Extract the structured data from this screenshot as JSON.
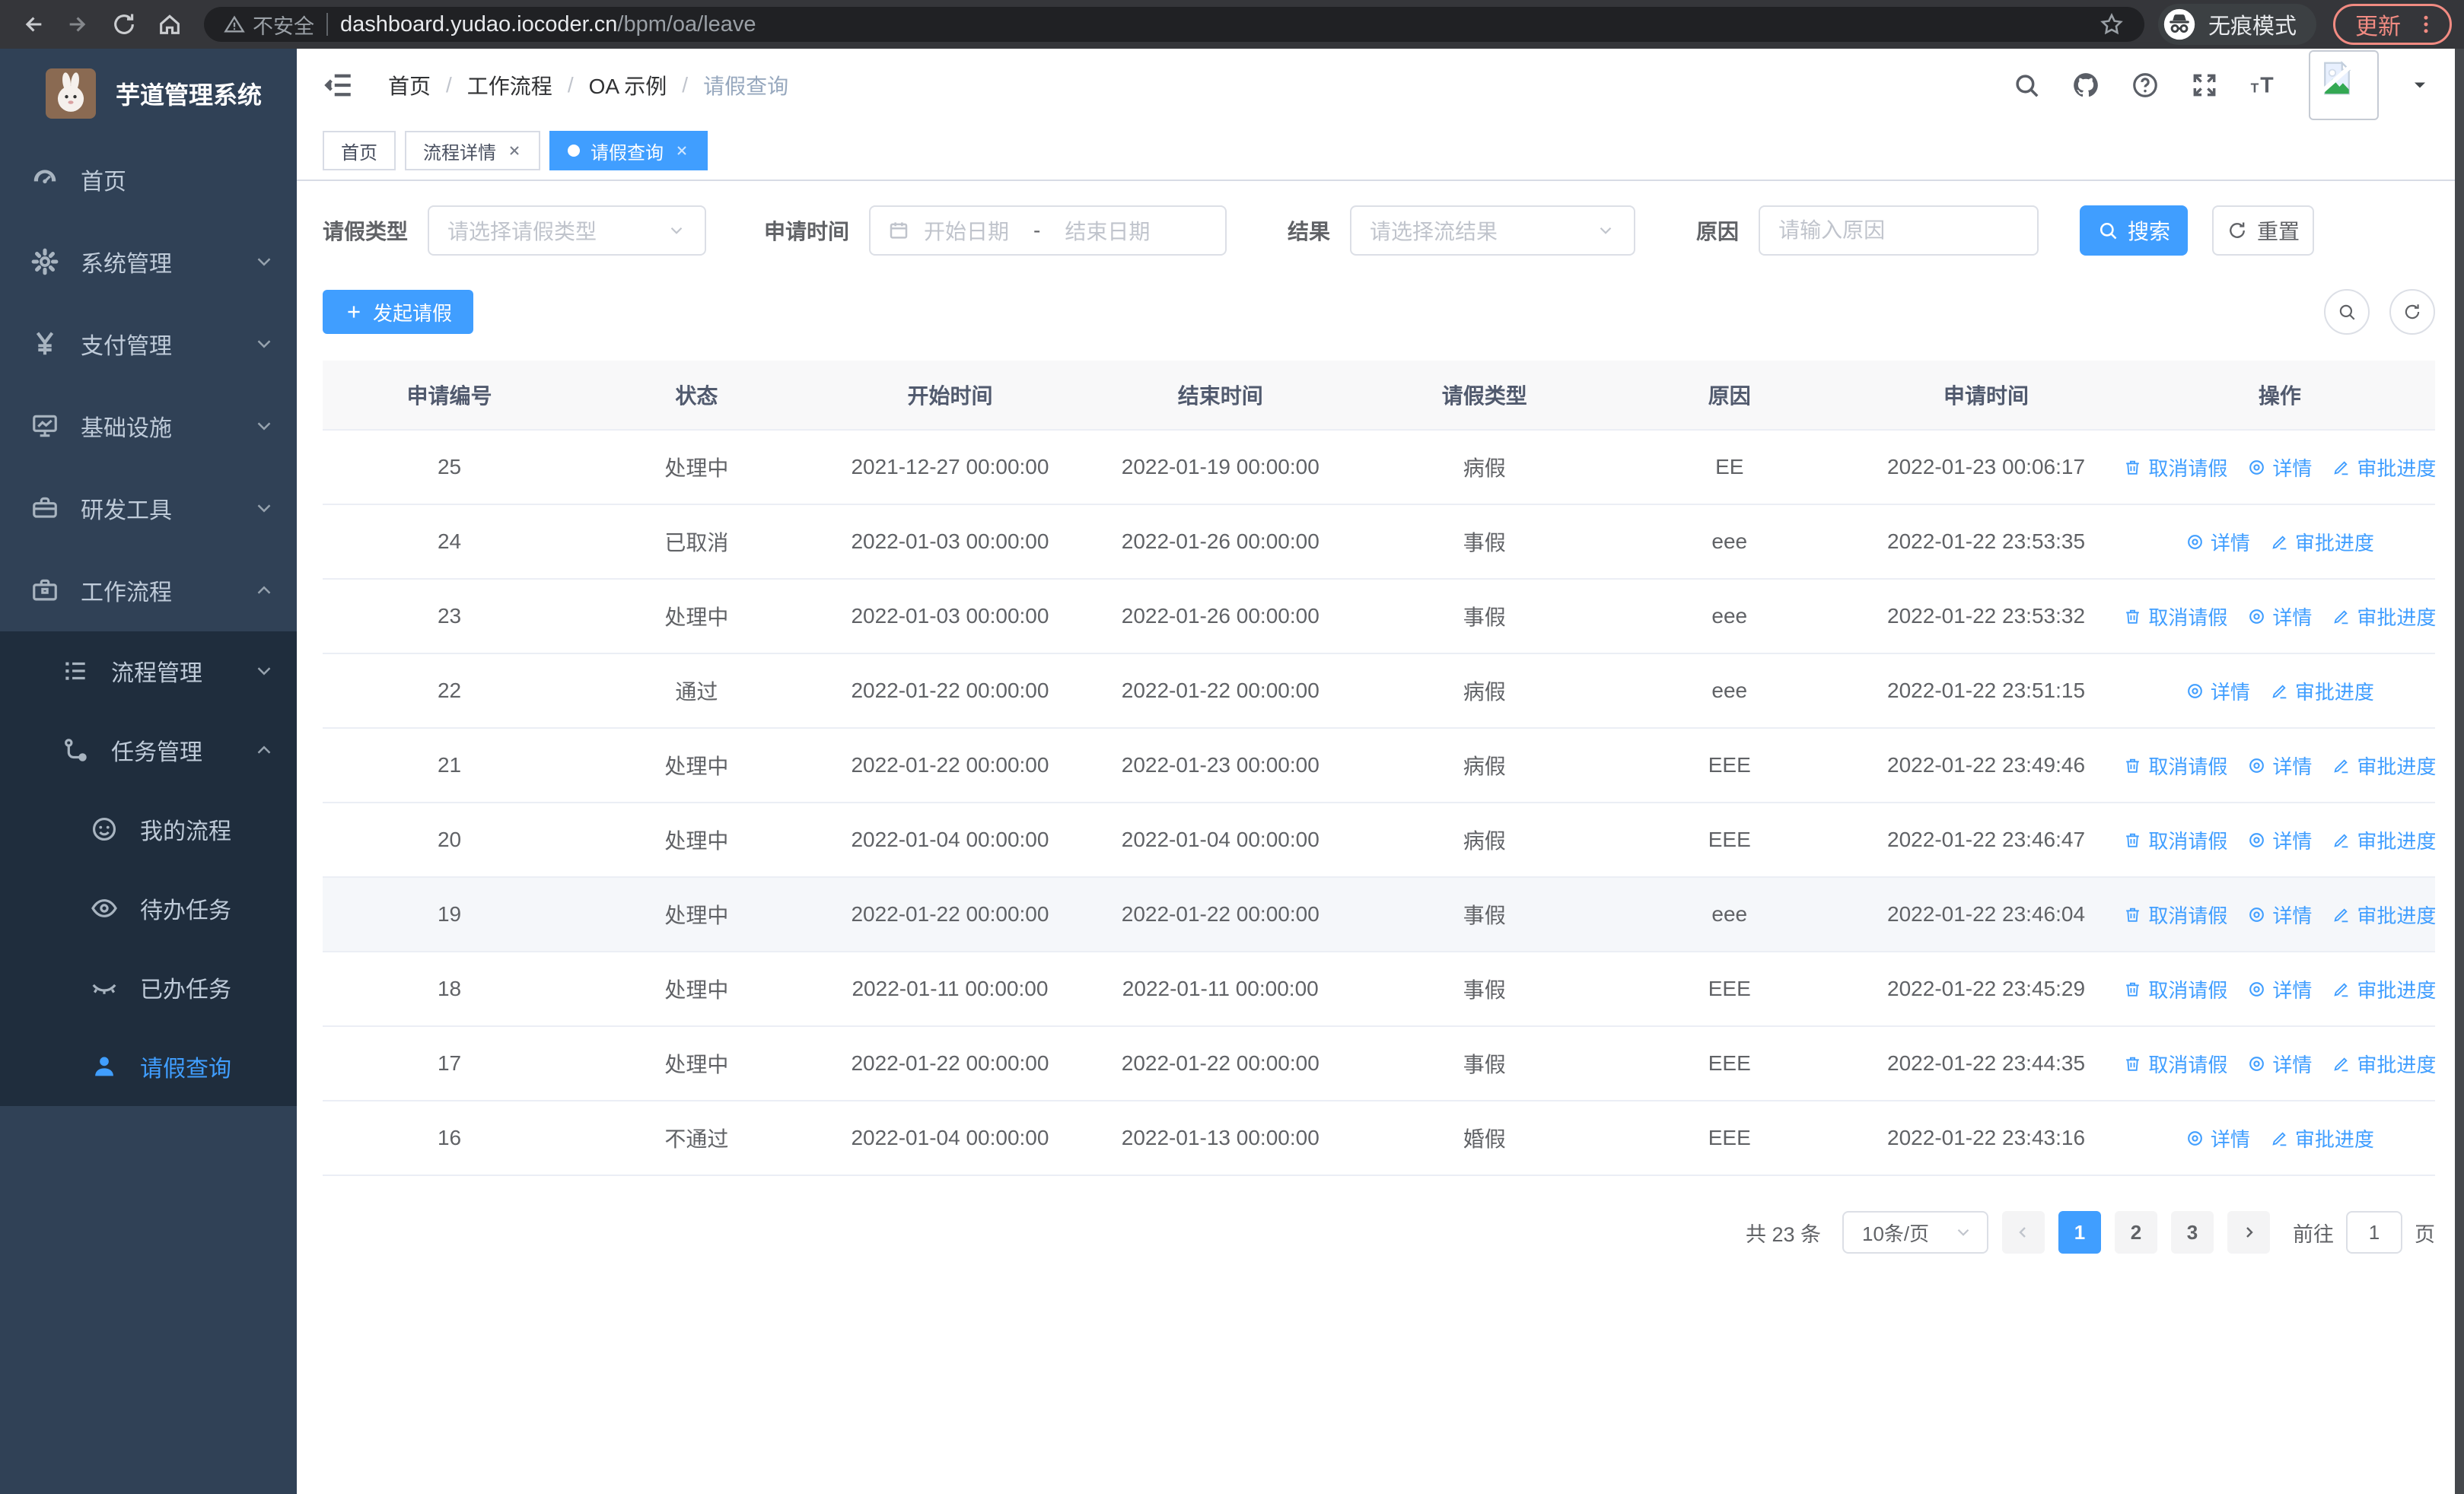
{
  "browser": {
    "security_warning": "不安全",
    "url_host": "dashboard.yudao.iocoder.cn",
    "url_path": "/bpm/oa/leave",
    "incognito_label": "无痕模式",
    "update_label": "更新"
  },
  "sidebar": {
    "title": "芋道管理系统",
    "items": [
      "首页",
      "系统管理",
      "支付管理",
      "基础设施",
      "研发工具",
      "工作流程"
    ],
    "submenu": [
      "流程管理",
      "任务管理"
    ],
    "task_items": [
      "我的流程",
      "待办任务",
      "已办任务",
      "请假查询"
    ],
    "active_item": "请假查询"
  },
  "header": {
    "breadcrumb": [
      "首页",
      "工作流程",
      "OA 示例",
      "请假查询"
    ]
  },
  "tabs": {
    "items": [
      {
        "label": "首页",
        "closable": false,
        "active": false
      },
      {
        "label": "流程详情",
        "closable": true,
        "active": false
      },
      {
        "label": "请假查询",
        "closable": true,
        "active": true
      }
    ]
  },
  "filters": {
    "leave_type_label": "请假类型",
    "leave_type_placeholder": "请选择请假类型",
    "apply_time_label": "申请时间",
    "start_date_placeholder": "开始日期",
    "range_separator": "-",
    "end_date_placeholder": "结束日期",
    "result_label": "结果",
    "result_placeholder": "请选择流结果",
    "reason_label": "原因",
    "reason_placeholder": "请输入原因",
    "search_label": "搜索",
    "reset_label": "重置"
  },
  "toolbar": {
    "create_label": "发起请假"
  },
  "table": {
    "headers": [
      "申请编号",
      "状态",
      "开始时间",
      "结束时间",
      "请假类型",
      "原因",
      "申请时间",
      "操作"
    ],
    "action_labels": {
      "cancel": "取消请假",
      "detail": "详情",
      "progress": "审批进度"
    },
    "rows": [
      {
        "id": "25",
        "status": "处理中",
        "start": "2021-12-27 00:00:00",
        "end": "2022-01-19 00:00:00",
        "type": "病假",
        "reason": "EE",
        "apply": "2022-01-23 00:06:17",
        "can_cancel": true,
        "highlight": false
      },
      {
        "id": "24",
        "status": "已取消",
        "start": "2022-01-03 00:00:00",
        "end": "2022-01-26 00:00:00",
        "type": "事假",
        "reason": "eee",
        "apply": "2022-01-22 23:53:35",
        "can_cancel": false,
        "highlight": false
      },
      {
        "id": "23",
        "status": "处理中",
        "start": "2022-01-03 00:00:00",
        "end": "2022-01-26 00:00:00",
        "type": "事假",
        "reason": "eee",
        "apply": "2022-01-22 23:53:32",
        "can_cancel": true,
        "highlight": false
      },
      {
        "id": "22",
        "status": "通过",
        "start": "2022-01-22 00:00:00",
        "end": "2022-01-22 00:00:00",
        "type": "病假",
        "reason": "eee",
        "apply": "2022-01-22 23:51:15",
        "can_cancel": false,
        "highlight": false
      },
      {
        "id": "21",
        "status": "处理中",
        "start": "2022-01-22 00:00:00",
        "end": "2022-01-23 00:00:00",
        "type": "病假",
        "reason": "EEE",
        "apply": "2022-01-22 23:49:46",
        "can_cancel": true,
        "highlight": false
      },
      {
        "id": "20",
        "status": "处理中",
        "start": "2022-01-04 00:00:00",
        "end": "2022-01-04 00:00:00",
        "type": "病假",
        "reason": "EEE",
        "apply": "2022-01-22 23:46:47",
        "can_cancel": true,
        "highlight": false
      },
      {
        "id": "19",
        "status": "处理中",
        "start": "2022-01-22 00:00:00",
        "end": "2022-01-22 00:00:00",
        "type": "事假",
        "reason": "eee",
        "apply": "2022-01-22 23:46:04",
        "can_cancel": true,
        "highlight": true
      },
      {
        "id": "18",
        "status": "处理中",
        "start": "2022-01-11 00:00:00",
        "end": "2022-01-11 00:00:00",
        "type": "事假",
        "reason": "EEE",
        "apply": "2022-01-22 23:45:29",
        "can_cancel": true,
        "highlight": false
      },
      {
        "id": "17",
        "status": "处理中",
        "start": "2022-01-22 00:00:00",
        "end": "2022-01-22 00:00:00",
        "type": "事假",
        "reason": "EEE",
        "apply": "2022-01-22 23:44:35",
        "can_cancel": true,
        "highlight": false
      },
      {
        "id": "16",
        "status": "不通过",
        "start": "2022-01-04 00:00:00",
        "end": "2022-01-13 00:00:00",
        "type": "婚假",
        "reason": "EEE",
        "apply": "2022-01-22 23:43:16",
        "can_cancel": false,
        "highlight": false
      }
    ]
  },
  "pagination": {
    "total_label": "共 23 条",
    "page_size_label": "10条/页",
    "pages": [
      "1",
      "2",
      "3"
    ],
    "active_page": "1",
    "goto_label": "前往",
    "goto_value": "1",
    "page_suffix_label": "页"
  },
  "colors": {
    "primary": "#409EFF",
    "sidebar_bg": "#304156",
    "submenu_bg": "#1f2d3d",
    "chrome_bg": "#35363a",
    "update_accent": "#f28b82",
    "link": "#409EFF"
  }
}
